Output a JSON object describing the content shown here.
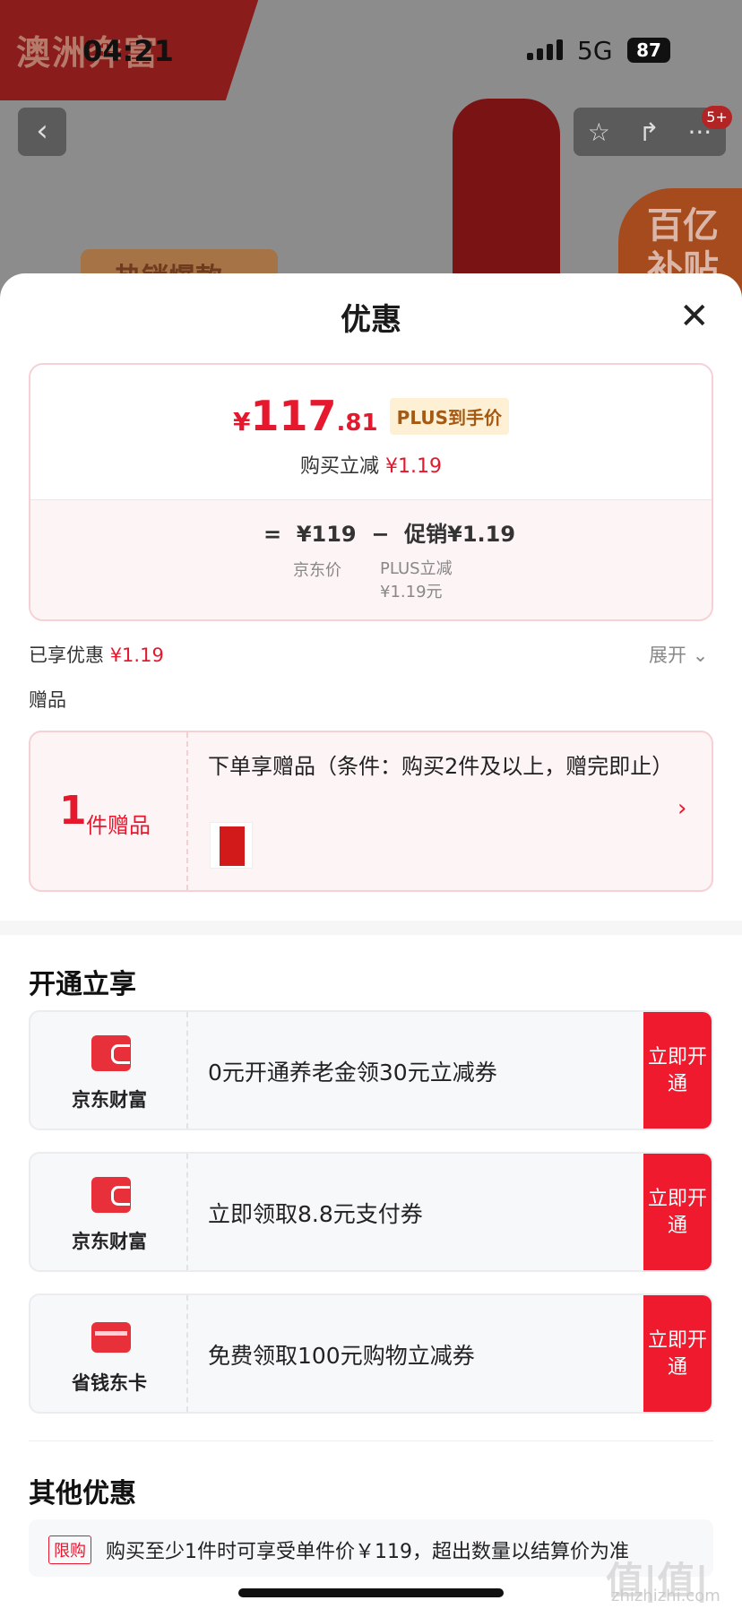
{
  "status": {
    "time": "04:21",
    "network": "5G",
    "battery": "87"
  },
  "background": {
    "brand": "澳洲奔富",
    "hot_label": "热销爆款",
    "subsidy": "百亿补贴",
    "cart_badge": "5+"
  },
  "sheet": {
    "title": "优惠",
    "price": {
      "symbol": "¥",
      "integer": "117",
      "decimal": ".81",
      "plus_tag": "PLUS到手价",
      "instant_label": "购买立减",
      "instant_value": "¥1.19",
      "formula": "=  ¥119  −  促销¥1.19",
      "jd_price_label": "京东价",
      "plus_reduce_label": "PLUS立减",
      "plus_reduce_value": "¥1.19元"
    },
    "enjoyed_label": "已享优惠",
    "enjoyed_value": "¥1.19",
    "expand_label": "展开",
    "gift_heading": "赠品",
    "gift": {
      "count": "1",
      "count_label": "件赠品",
      "description": "下单享赠品（条件：购买2件及以上，赠完即止）"
    },
    "open_section_title": "开通立享",
    "offers": [
      {
        "name": "京东财富",
        "text": "0元开通养老金领30元立减券",
        "button": "立即开通",
        "icon": "wallet-icon"
      },
      {
        "name": "京东财富",
        "text": "立即领取8.8元支付券",
        "button": "立即开通",
        "icon": "wallet-icon"
      },
      {
        "name": "省钱东卡",
        "text": "免费领取100元购物立减券",
        "button": "立即开通",
        "icon": "card-icon"
      }
    ],
    "other_section_title": "其他优惠",
    "other": {
      "tag": "限购",
      "text": "购买至少1件时可享受单件价￥119，超出数量以结算价为准"
    }
  },
  "watermark": {
    "main": "值|值|值",
    "sub": "zhizhizhi.com"
  },
  "colors": {
    "accent": "#e6182e",
    "button": "#f01a2e",
    "plus_tag_bg": "#fdf0d5"
  }
}
